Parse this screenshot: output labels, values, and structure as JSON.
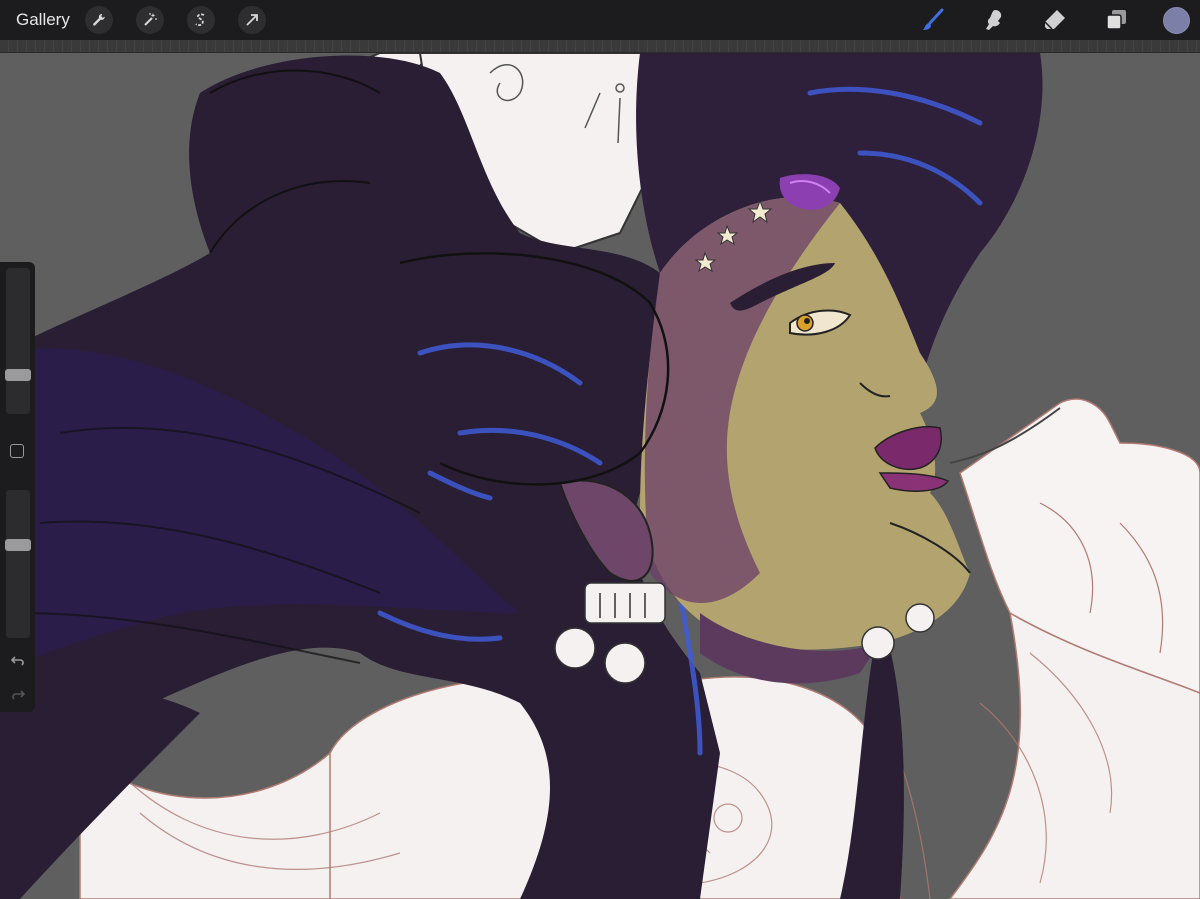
{
  "toolbar": {
    "gallery_label": "Gallery",
    "left_tools": [
      "wrench-icon",
      "magic-wand-icon",
      "selection-icon",
      "transform-arrow-icon"
    ],
    "right_tools": [
      "brush-icon",
      "smudge-icon",
      "eraser-icon",
      "layers-icon"
    ],
    "active_tool": "brush-icon",
    "active_color": "#7c80a8",
    "accent_color": "#3f6fe0"
  },
  "sidebar": {
    "brush_size_level": 0.25,
    "opacity_level": 0.36,
    "icons": [
      "modify-square-icon",
      "undo-icon",
      "redo-icon"
    ]
  },
  "canvas": {
    "background_color": "#5f5f5f",
    "artwork": "illustration-in-progress"
  }
}
